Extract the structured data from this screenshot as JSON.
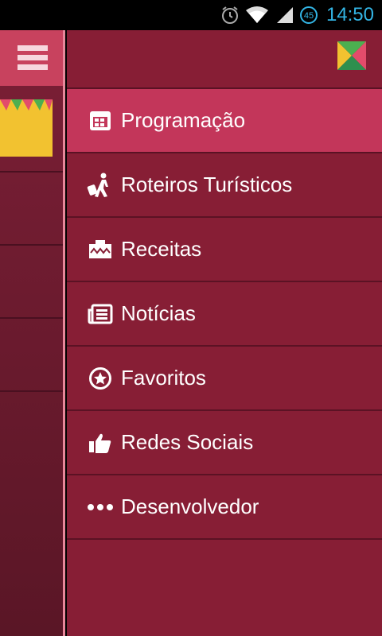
{
  "status_bar": {
    "time": "14:50",
    "badge": "45"
  },
  "menu": {
    "items": [
      {
        "label": "Programação",
        "icon": "calendar-icon",
        "active": true
      },
      {
        "label": "Roteiros Turísticos",
        "icon": "traveler-icon"
      },
      {
        "label": "Receitas",
        "icon": "recipe-box-icon"
      },
      {
        "label": "Notícias",
        "icon": "newspaper-icon"
      },
      {
        "label": "Favoritos",
        "icon": "star-circle-icon"
      },
      {
        "label": "Redes Sociais",
        "icon": "thumbs-up-icon"
      },
      {
        "label": "Desenvolvedor",
        "icon": "more-dots-icon"
      }
    ]
  },
  "colors": {
    "drawer": "#871e35",
    "active": "#c3365a",
    "accent_time": "#33b5e5"
  }
}
